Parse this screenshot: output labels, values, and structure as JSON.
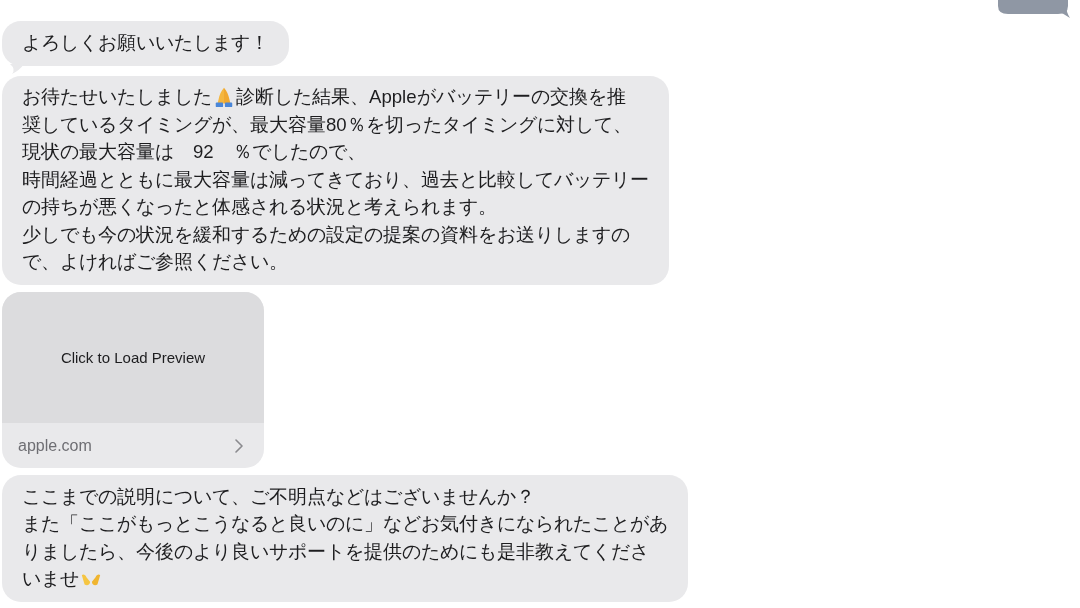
{
  "cut_off_bubble": {
    "shown": true
  },
  "messages": [
    {
      "kind": "text",
      "tail": true,
      "lines": [
        [
          {
            "kind": "text",
            "text": "よろしくお願いいたします！"
          }
        ]
      ]
    },
    {
      "kind": "text",
      "tail": false,
      "lines": [
        [
          {
            "kind": "text",
            "text": "お待たせいたしました"
          },
          {
            "kind": "praying"
          },
          {
            "kind": "text",
            "text": "診断した結果、Appleがバッテリーの交換を推"
          }
        ],
        [
          {
            "kind": "text",
            "text": "奨しているタイミングが、最大容量80％を切ったタイミングに対して、"
          }
        ],
        [
          {
            "kind": "text",
            "text": "現状の最大容量は　92　％でしたので、"
          }
        ],
        [
          {
            "kind": "text",
            "text": "時間経過とともに最大容量は減ってきており、過去と比較してバッテリー"
          }
        ],
        [
          {
            "kind": "text",
            "text": "の持ちが悪くなったと体感される状況と考えられます。"
          }
        ],
        [
          {
            "kind": "text",
            "text": "少しでも今の状況を緩和するための設定の提案の資料をお送りしますの"
          }
        ],
        [
          {
            "kind": "text",
            "text": "で、よければご参照ください。"
          }
        ]
      ]
    },
    {
      "kind": "link",
      "preview": "Click to Load Preview",
      "domain": "apple.com"
    },
    {
      "kind": "text",
      "tail": false,
      "lines": [
        [
          {
            "kind": "text",
            "text": "ここまでの説明について、ご不明点などはございませんか？"
          }
        ],
        [
          {
            "kind": "text",
            "text": "また「ここがもっとこうなると良いのに」などお気付きになられたことがあ"
          }
        ],
        [
          {
            "kind": "text",
            "text": "りましたら、今後のより良いサポートを提供のためにも是非教えてくださ"
          }
        ],
        [
          {
            "kind": "text",
            "text": "いませ"
          },
          {
            "kind": "hands"
          }
        ]
      ]
    }
  ]
}
